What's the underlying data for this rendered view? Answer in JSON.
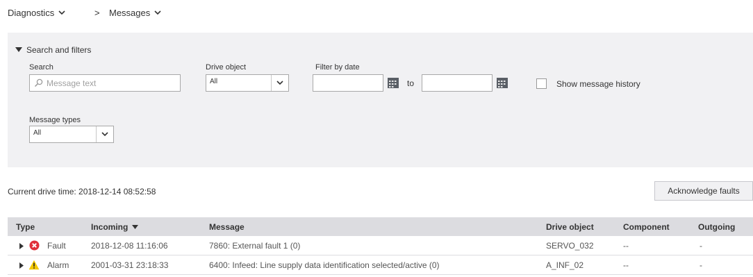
{
  "breadcrumb": {
    "item1": "Diagnostics",
    "separator": ">",
    "item2": "Messages"
  },
  "filters": {
    "title": "Search and filters",
    "search_label": "Search",
    "search_placeholder": "Message text",
    "drive_object_label": "Drive object",
    "drive_object_value": "All",
    "date_label": "Filter by date",
    "date_from": "",
    "to_label": "to",
    "date_to": "",
    "history_label": "Show message history",
    "message_types_label": "Message types",
    "message_types_value": "All"
  },
  "status": {
    "drive_time": "Current drive time: 2018-12-14 08:52:58",
    "ack_button": "Acknowledge faults"
  },
  "table": {
    "headers": {
      "type": "Type",
      "incoming": "Incoming",
      "message": "Message",
      "drive_object": "Drive object",
      "component": "Component",
      "outgoing": "Outgoing"
    },
    "rows": [
      {
        "type": "Fault",
        "icon": "fault-icon",
        "incoming": "2018-12-08 11:16:06",
        "message": "7860: External fault 1 (0)",
        "drive_object": "SERVO_032",
        "component": "--",
        "outgoing": "-"
      },
      {
        "type": "Alarm",
        "icon": "warning-icon",
        "incoming": "2001-03-31 23:18:33",
        "message": "6400: Infeed: Line supply data identification selected/active (0)",
        "drive_object": "A_INF_02",
        "component": "--",
        "outgoing": "-"
      }
    ]
  },
  "colors": {
    "fault": "#e0303a",
    "alarm": "#f4c900",
    "panel_bg": "#f1f1f3",
    "header_bg": "#dcdce0"
  }
}
